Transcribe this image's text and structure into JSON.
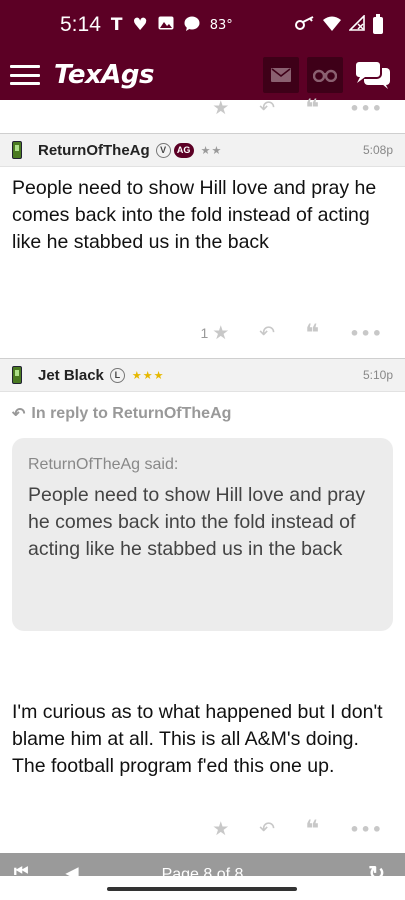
{
  "status_bar": {
    "time": "5:14",
    "temperature": "83°"
  },
  "app": {
    "title": "TexAgs",
    "mail_icon": "mail-icon",
    "watch_icon": "binoculars-icon",
    "chat_icon": "chat-icon"
  },
  "posts": [
    {
      "username": "ReturnOfTheAg",
      "badges": [
        "V",
        "AG"
      ],
      "stars": "★★",
      "star_color": "#9a9a9a",
      "time": "5:08p",
      "body": "People need to show Hill love and pray he comes back into the fold instead of acting like he stabbed us in the back",
      "like_count": "1"
    },
    {
      "username": "Jet Black",
      "badges": [
        "L"
      ],
      "stars": "★★★",
      "star_color": "#e6b800",
      "time": "5:10p",
      "reply_to": "In reply to ReturnOfTheAg",
      "quote_author": "ReturnOfTheAg said:",
      "quote_body": "People need to show Hill love and pray he comes back into the fold instead of acting like he stabbed us in the back",
      "body": "I'm curious as to what happened but I don't blame him at all. This is all A&M's doing. The football program f'ed this one up."
    }
  ],
  "pager": {
    "label": "Page 8 of 8"
  },
  "colors": {
    "brand": "#5c0025",
    "brand_dark": "#3e0018",
    "pager_bg": "#9a9a9a"
  }
}
